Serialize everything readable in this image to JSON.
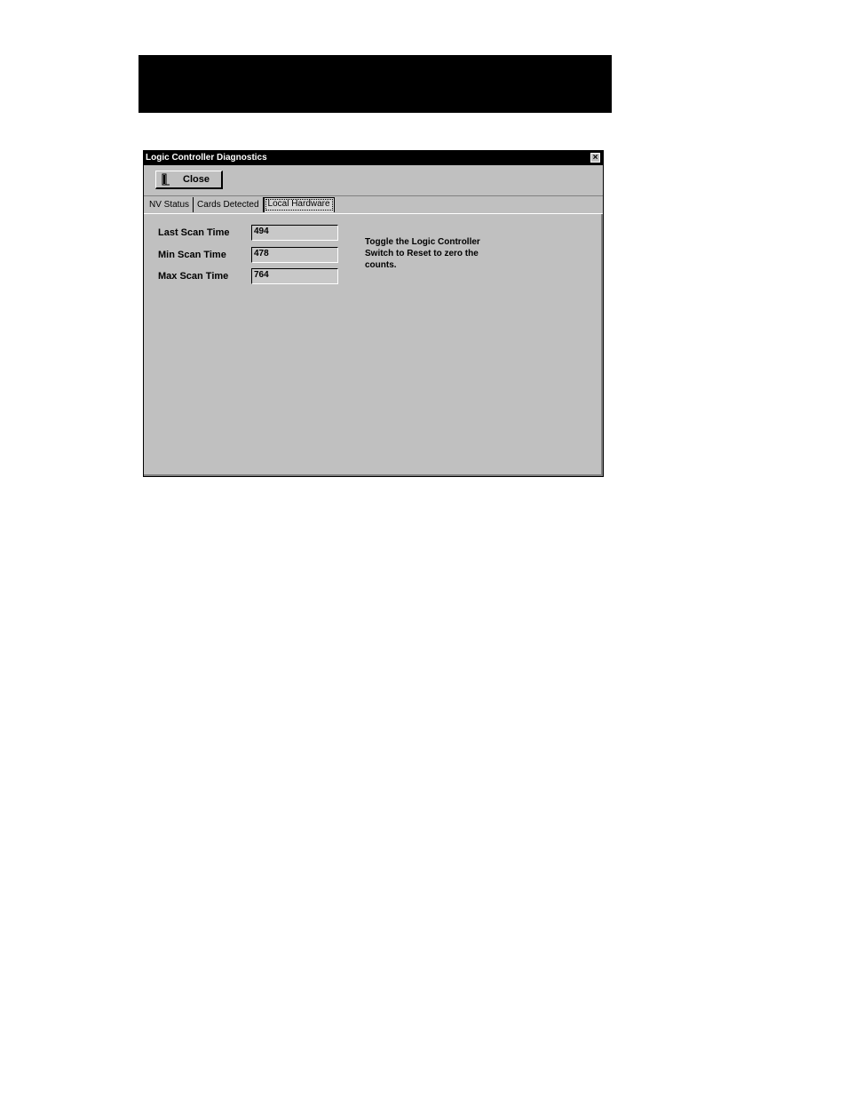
{
  "window": {
    "title": "Logic Controller Diagnostics",
    "close_glyph": "×"
  },
  "toolbar": {
    "close_label": "Close",
    "close_icon": "door-exit-icon"
  },
  "tabs": [
    {
      "label": "NV Status",
      "active": false
    },
    {
      "label": "Cards Detected",
      "active": false
    },
    {
      "label": "Local Hardware",
      "active": true
    }
  ],
  "fields": {
    "last_scan": {
      "label": "Last Scan Time",
      "value": "494"
    },
    "min_scan": {
      "label": "Min Scan Time",
      "value": "478"
    },
    "max_scan": {
      "label": "Max Scan Time",
      "value": "764"
    }
  },
  "note": "Toggle the Logic Controller Switch to Reset to zero the counts."
}
